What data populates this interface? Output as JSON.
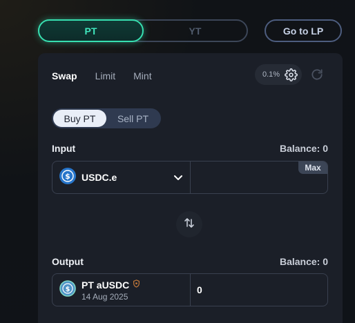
{
  "mode_toggle": {
    "pt_label": "PT",
    "yt_label": "YT"
  },
  "go_lp_label": "Go to LP",
  "tabs": [
    "Swap",
    "Limit",
    "Mint"
  ],
  "slippage": "0.1%",
  "buy_sell": {
    "buy_label": "Buy PT",
    "sell_label": "Sell PT"
  },
  "input": {
    "label": "Input",
    "balance": "Balance: 0",
    "token": "USDC.e",
    "amount": "",
    "max_label": "Max"
  },
  "output": {
    "label": "Output",
    "balance": "Balance: 0",
    "token": "PT aUSDC",
    "maturity": "14 Aug 2025",
    "amount": "0"
  },
  "colors": {
    "accent": "#37e0b0",
    "card": "#1b1f28",
    "usdc_blue": "#2775ca"
  }
}
